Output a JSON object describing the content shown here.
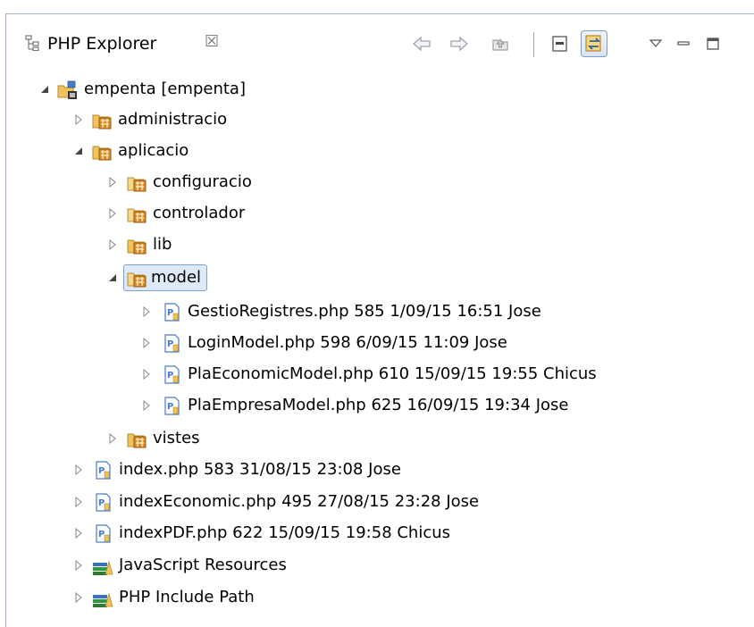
{
  "view": {
    "title": "PHP Explorer",
    "close_glyph": "☒"
  },
  "toolbar": {
    "buttons": [
      {
        "name": "back-arrow-icon"
      },
      {
        "name": "forward-arrow-icon"
      },
      {
        "name": "up-folder-icon"
      },
      {
        "name": "collapse-all-icon"
      },
      {
        "name": "link-with-editor-icon",
        "pressed": true
      },
      {
        "name": "view-menu-icon"
      },
      {
        "name": "minimize-icon"
      },
      {
        "name": "maximize-icon"
      }
    ]
  },
  "tree": {
    "root": {
      "label": "empenta [empenta]"
    },
    "administracio": {
      "label": "administracio"
    },
    "aplicacio": {
      "label": "aplicacio"
    },
    "configuracio": {
      "label": "configuracio"
    },
    "controlador": {
      "label": "controlador"
    },
    "lib": {
      "label": "lib"
    },
    "model": {
      "label": "model"
    },
    "model_files": [
      {
        "label": "GestioRegistres.php 585  1/09/15 16:51  Jose"
      },
      {
        "label": "LoginModel.php 598  6/09/15 11:09  Jose"
      },
      {
        "label": "PlaEconomicModel.php 610  15/09/15 19:55  Chicus"
      },
      {
        "label": "PlaEmpresaModel.php 625  16/09/15 19:34  Jose"
      }
    ],
    "vistes": {
      "label": "vistes"
    },
    "root_files": [
      {
        "label": "index.php 583  31/08/15 23:08  Jose"
      },
      {
        "label": "indexEconomic.php 495  27/08/15 23:28  Jose"
      },
      {
        "label": "indexPDF.php 622  15/09/15 19:58  Chicus"
      }
    ],
    "libraries": [
      {
        "label": "JavaScript Resources"
      },
      {
        "label": "PHP Include Path"
      }
    ]
  },
  "colors": {
    "selection_bg": "#dfeaf9",
    "selection_border": "#7da2ce",
    "folder_yellow": "#f2c25a",
    "package_orange": "#d88a2a",
    "php_file_blue": "#4a7bc8"
  }
}
